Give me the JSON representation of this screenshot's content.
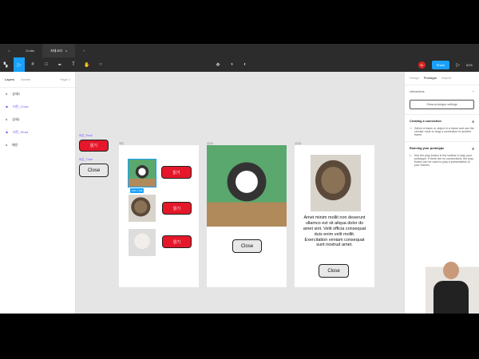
{
  "tabs": [
    "Drafts",
    "카테고리"
  ],
  "toolbar": {
    "share": "Share",
    "zoom": "62%",
    "avatar": "M"
  },
  "layers": {
    "tab_layers": "Layers",
    "tab_assets": "Assets",
    "page": "Page 1",
    "items": [
      {
        "name": "상세2",
        "type": "frame"
      },
      {
        "name": "버튼_Close",
        "type": "component"
      },
      {
        "name": "상세1",
        "type": "frame"
      },
      {
        "name": "버튼_Read",
        "type": "component"
      },
      {
        "name": "메인",
        "type": "frame"
      }
    ]
  },
  "canvas": {
    "frames": [
      "메인",
      "상세1",
      "상세2"
    ],
    "components": {
      "read_label": "버튼_Read",
      "read_text": "읽기",
      "close_label": "버튼_Close",
      "close_text": "Close"
    },
    "main_buttons": [
      "읽기",
      "읽기",
      "읽기"
    ],
    "size_badge": "106 × 106",
    "detail1_close": "Close",
    "detail2_text": "Amet minim mollit non deserunt ullamco est sit aliqua dolor do amet sint. Velit officia consequat duis enim velit mollit. Exercitation veniam consequat sunt nostrud amet.",
    "detail2_close": "Close"
  },
  "panel": {
    "tabs": [
      "Design",
      "Prototype",
      "Inspect"
    ],
    "interactions": "Interactions",
    "settings_btn": "Show prototype settings",
    "conn_title": "Creating a connection",
    "conn_text": "Select a frame or object in a frame and use the circular node to drag a connection to another frame.",
    "run_title": "Running your prototype",
    "run_text": "Use the play button in the toolbar to play your prototype. If there are no connections, the play button can be used to play a presentation of your frames."
  }
}
